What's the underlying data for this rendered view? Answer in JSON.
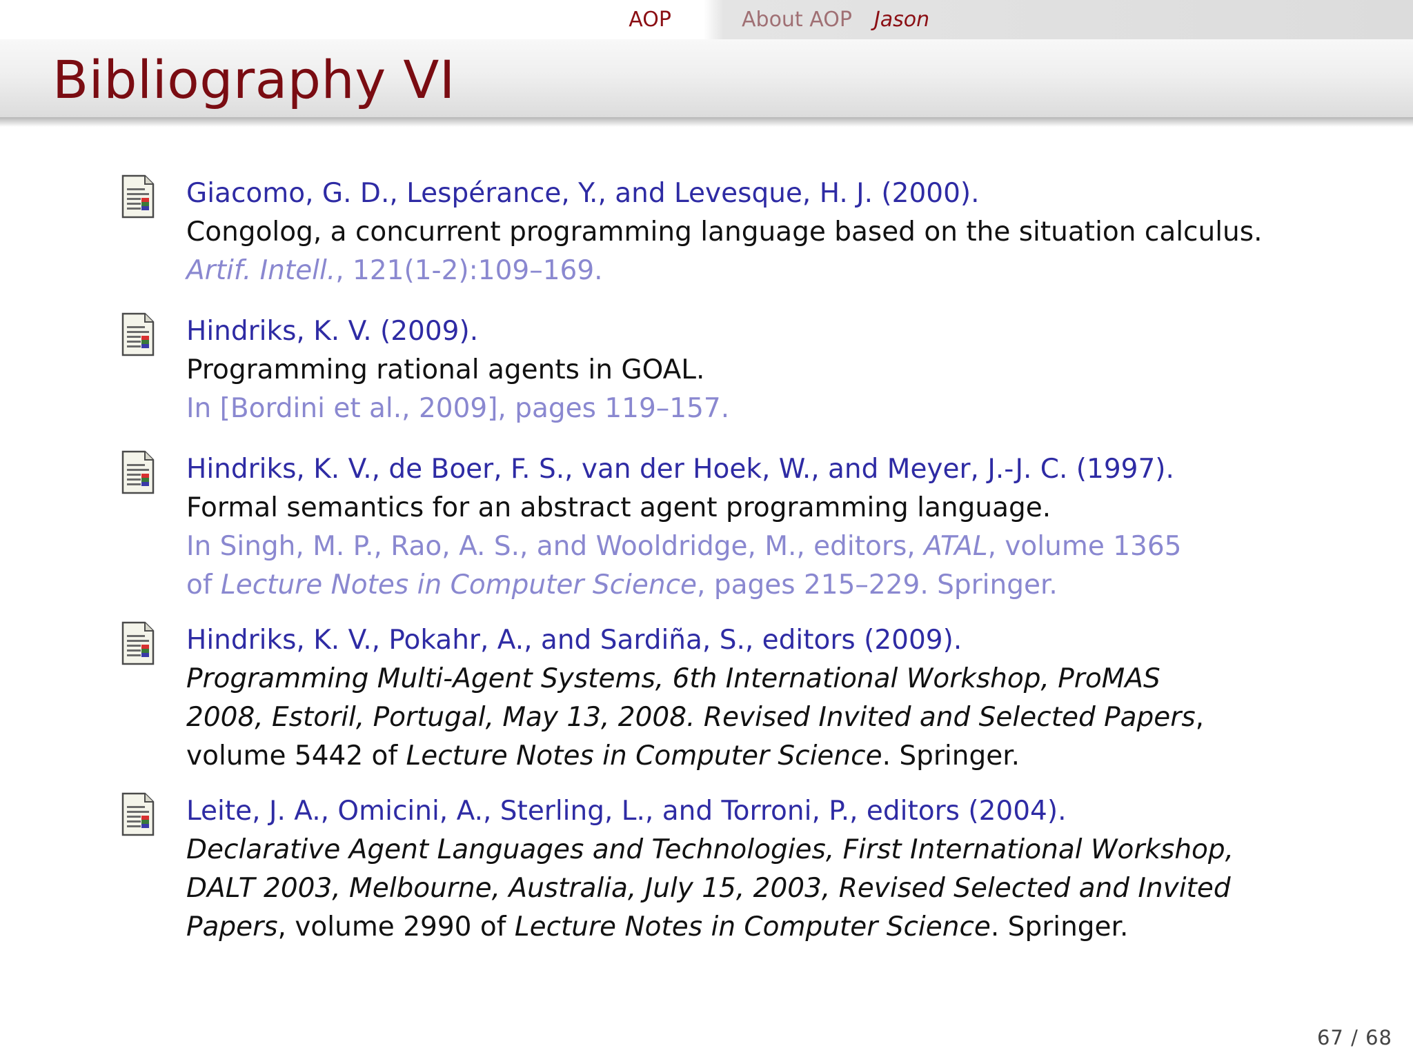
{
  "nav": {
    "current": "AOP",
    "section": "About AOP",
    "subsection": "Jason"
  },
  "page_title": "Bibliography VI",
  "entries": [
    {
      "authors": "Giacomo, G. D., Lespérance, Y., and Levesque, H. J. (2000).",
      "title": "Congolog, a concurrent programming language based on the situation calculus.",
      "pub_journal": "Artif. Intell.",
      "pub_rest": ", 121(1-2):109–169."
    },
    {
      "authors": "Hindriks, K. V. (2009).",
      "title": "Programming rational agents in GOAL.",
      "pub": "In [Bordini et al., 2009], pages 119–157."
    },
    {
      "authors": "Hindriks, K. V., de Boer, F. S., van der Hoek, W., and Meyer, J.-J. C. (1997).",
      "title": "Formal semantics for an abstract agent programming language.",
      "pub_a": "In Singh, M. P., Rao, A. S., and Wooldridge, M., editors, ",
      "pub_b": "ATAL",
      "pub_c": ", volume 1365",
      "pub_d": "of ",
      "pub_e": "Lecture Notes in Computer Science",
      "pub_f": ", pages 215–229. Springer."
    },
    {
      "authors": "Hindriks, K. V., Pokahr, A., and Sardiña, S., editors (2009).",
      "title_line1": "Programming Multi-Agent Systems, 6th International Workshop, ProMAS",
      "title_line2": "2008, Estoril, Portugal, May 13, 2008. Revised Invited and Selected Papers",
      "title_line2_tail": ",",
      "title_line3_a": "volume 5442 of ",
      "title_line3_b": "Lecture Notes in Computer Science",
      "title_line3_c": ". Springer."
    },
    {
      "authors": "Leite, J. A., Omicini, A., Sterling, L., and Torroni, P., editors (2004).",
      "title_line1": "Declarative Agent Languages and Technologies, First International Workshop,",
      "title_line2": "DALT 2003, Melbourne, Australia, July 15, 2003, Revised Selected and Invited",
      "title_line3_a": "Papers",
      "title_line3_b": ", volume 2990 of ",
      "title_line3_c": "Lecture Notes in Computer Science",
      "title_line3_d": ". Springer."
    }
  ],
  "page_number": "67 / 68",
  "icon_name": "document-icon",
  "colors": {
    "title": "#7a0c12",
    "authors": "#2e2ba4",
    "publication": "#8a88d0",
    "nav_current": "#8b0f14"
  }
}
